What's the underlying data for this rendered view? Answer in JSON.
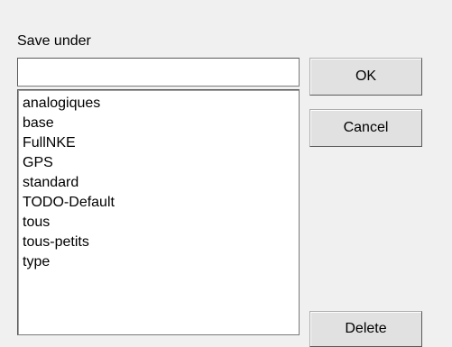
{
  "dialog": {
    "save_label": "Save under",
    "name_value": "",
    "items": [
      "analogiques",
      "base",
      "FullNKE",
      "GPS",
      "standard",
      "TODO-Default",
      "tous",
      "tous-petits",
      "type"
    ],
    "buttons": {
      "ok": "OK",
      "cancel": "Cancel",
      "delete": "Delete"
    }
  }
}
